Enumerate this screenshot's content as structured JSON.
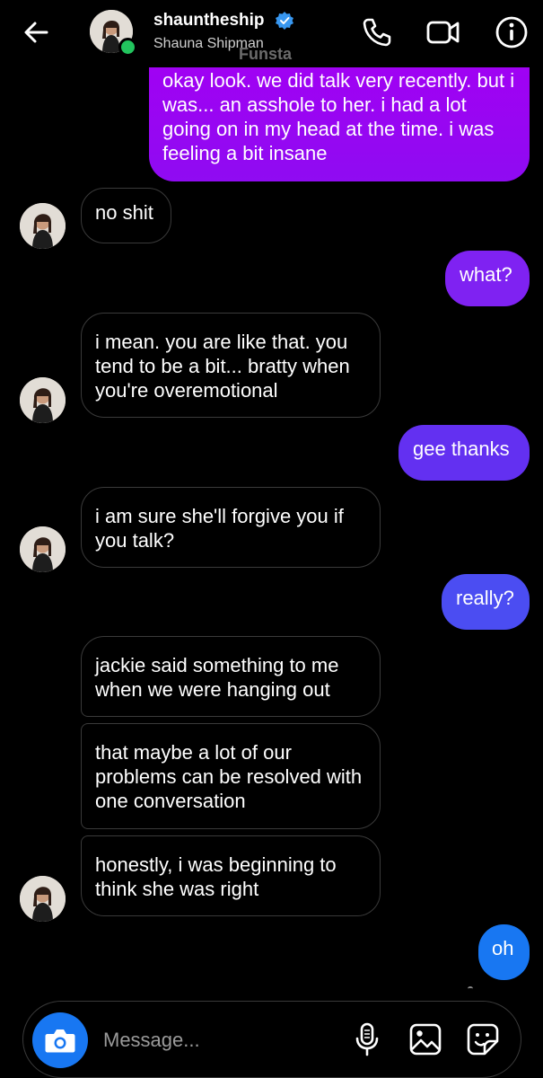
{
  "header": {
    "username": "shauntheship",
    "display_name": "Shauna Shipman",
    "watermark": "Funsta",
    "verified": true,
    "online": true,
    "icons": [
      "back-arrow-icon",
      "phone-icon",
      "video-camera-icon",
      "info-icon"
    ]
  },
  "messages": [
    {
      "side": "out",
      "text": "okay look. we did talk very recently. but i was... an asshole to her. i had a lot going on in my head at the time. i was feeling a bit insane"
    },
    {
      "side": "in",
      "text": "no shit"
    },
    {
      "side": "out",
      "text": "what?"
    },
    {
      "side": "in",
      "text": "i mean. you are like that. you tend to be a bit... bratty when you're overemotional"
    },
    {
      "side": "out",
      "text": "gee thanks"
    },
    {
      "side": "in",
      "text": "i am sure she'll forgive you if you talk?"
    },
    {
      "side": "out",
      "text": "really?"
    },
    {
      "side": "in",
      "text": "jackie said something to me when we were hanging out"
    },
    {
      "side": "in",
      "text": "that maybe a lot of our problems can be resolved with one conversation"
    },
    {
      "side": "in",
      "text": "honestly, i was beginning to think she was right"
    },
    {
      "side": "out",
      "text": "oh"
    }
  ],
  "composer": {
    "placeholder": "Message...",
    "icons": [
      "camera-icon",
      "microphone-icon",
      "gallery-icon",
      "sticker-icon"
    ]
  },
  "colors": {
    "background": "#000000",
    "outgoing_top": "#a000f0",
    "outgoing_mid": "#5b3cf0",
    "outgoing_bottom": "#1877f2",
    "incoming_border": "#3a3a3a",
    "verified_badge": "#3897f0",
    "online_dot": "#22c45e"
  }
}
